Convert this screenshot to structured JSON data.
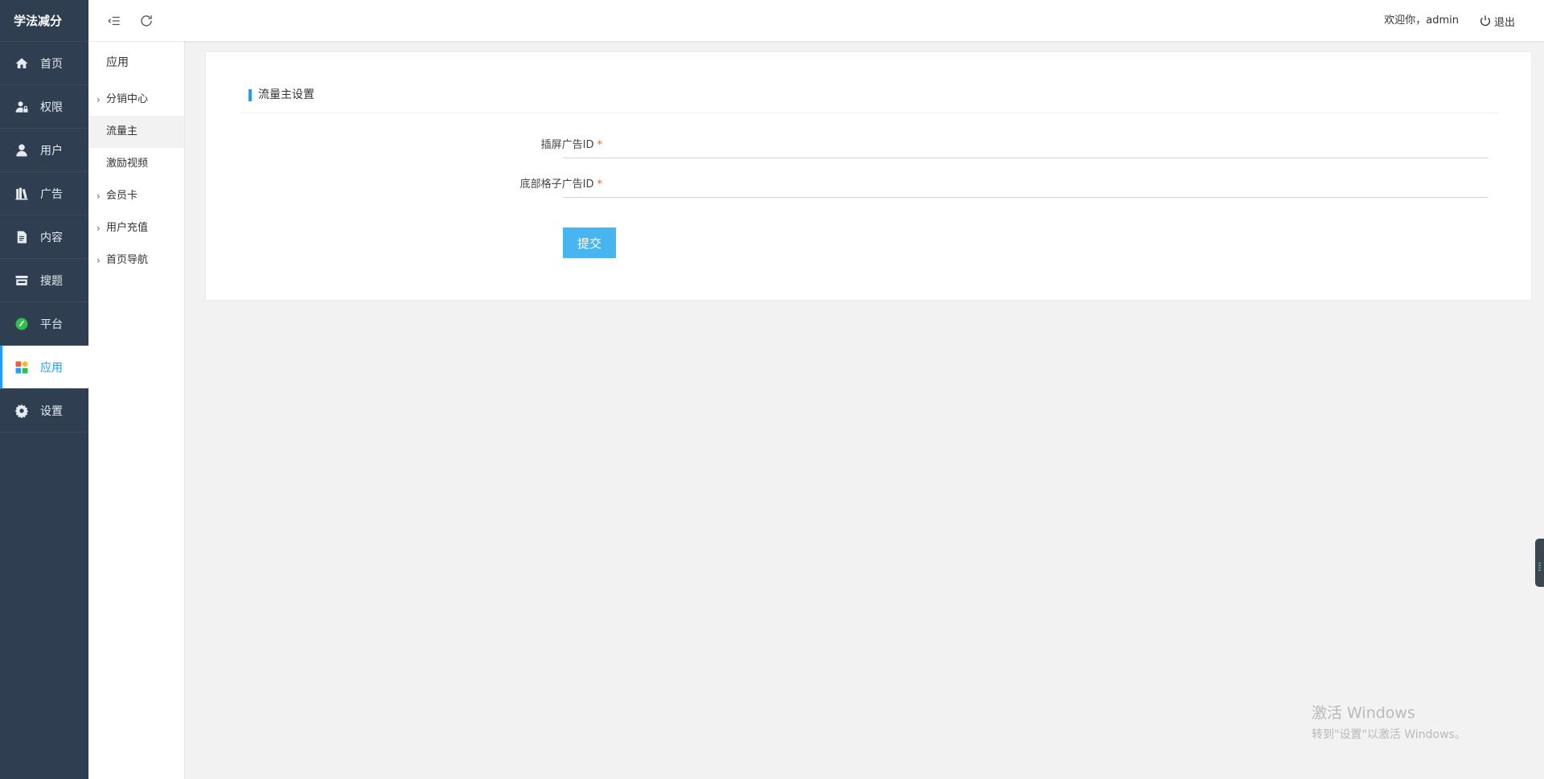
{
  "brand": "学法减分",
  "sidebar": {
    "items": [
      {
        "label": "首页",
        "icon": "home-icon"
      },
      {
        "label": "权限",
        "icon": "user-lock-icon"
      },
      {
        "label": "用户",
        "icon": "user-icon"
      },
      {
        "label": "广告",
        "icon": "books-icon"
      },
      {
        "label": "内容",
        "icon": "document-icon"
      },
      {
        "label": "搜题",
        "icon": "store-icon"
      },
      {
        "label": "平台",
        "icon": "platform-icon"
      },
      {
        "label": "应用",
        "icon": "apps-icon",
        "active": true
      },
      {
        "label": "设置",
        "icon": "gear-icon"
      }
    ]
  },
  "submenu": {
    "head": "应用",
    "items": [
      {
        "label": "分销中心",
        "has_children": true
      },
      {
        "label": "流量主",
        "has_children": false,
        "active": true
      },
      {
        "label": "激励视频",
        "has_children": false
      },
      {
        "label": "会员卡",
        "has_children": true
      },
      {
        "label": "用户充值",
        "has_children": true
      },
      {
        "label": "首页导航",
        "has_children": true
      }
    ]
  },
  "topbar": {
    "welcome": "欢迎你，admin",
    "logout_label": "退出"
  },
  "main": {
    "section_title": "流量主设置",
    "fields": [
      {
        "label": "插屏广告ID",
        "required": true,
        "value": ""
      },
      {
        "label": "底部格子广告ID",
        "required": true,
        "value": ""
      }
    ],
    "submit_label": "提交"
  },
  "watermark": {
    "line1": "激活 Windows",
    "line2": "转到\"设置\"以激活 Windows。"
  },
  "colors": {
    "sidebar_bg": "#2f3e51",
    "accent": "#1e9fff",
    "button": "#47b5f0",
    "required": "#ff5722"
  }
}
